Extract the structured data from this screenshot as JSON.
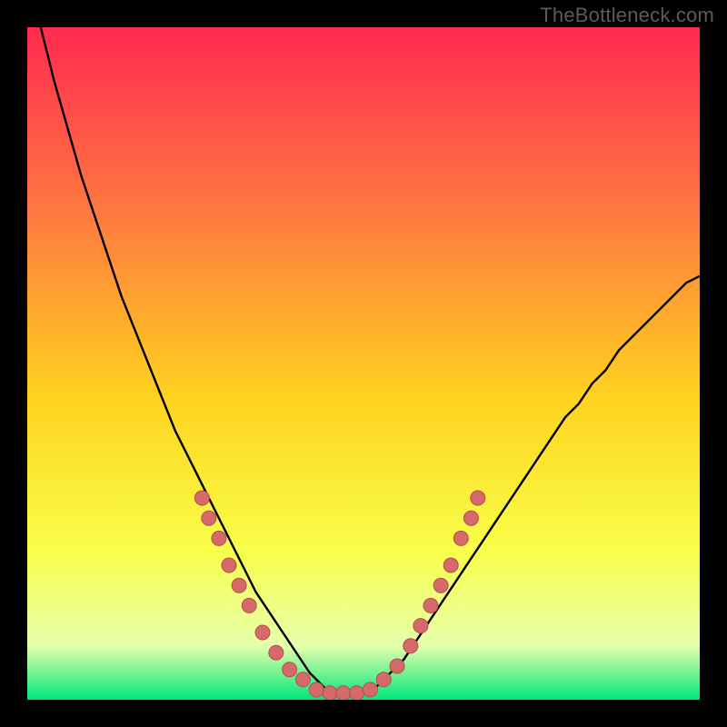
{
  "watermark": "TheBottleneck.com",
  "colors": {
    "frame": "#000000",
    "gradient_top": "#ff2a4f",
    "gradient_mid_upper": "#ff7a3f",
    "gradient_mid": "#ffd21f",
    "gradient_mid_lower": "#f8ff4a",
    "gradient_low": "#e6ffac",
    "gradient_bottom": "#00e67a",
    "curve": "#000000",
    "marker_fill": "#d46a6a",
    "marker_stroke": "#b44d4d"
  },
  "chart_data": {
    "type": "line",
    "title": "",
    "xlabel": "",
    "ylabel": "",
    "xlim": [
      0,
      100
    ],
    "ylim": [
      0,
      100
    ],
    "series": [
      {
        "name": "bottleneck-curve",
        "x": [
          0,
          2,
          4,
          6,
          8,
          10,
          12,
          14,
          16,
          18,
          20,
          22,
          24,
          26,
          28,
          30,
          32,
          34,
          36,
          38,
          40,
          42,
          44,
          45,
          46,
          48,
          50,
          52,
          54,
          56,
          58,
          60,
          62,
          64,
          66,
          68,
          70,
          72,
          74,
          76,
          78,
          80,
          82,
          84,
          86,
          88,
          90,
          92,
          94,
          96,
          98,
          100
        ],
        "y": [
          108,
          100,
          92,
          85,
          78,
          72,
          66,
          60,
          55,
          50,
          45,
          40,
          36,
          32,
          28,
          24,
          20,
          16,
          13,
          10,
          7,
          4,
          2,
          1,
          1,
          1,
          1,
          2,
          4,
          6,
          9,
          12,
          15,
          18,
          21,
          24,
          27,
          30,
          33,
          36,
          39,
          42,
          44,
          47,
          49,
          52,
          54,
          56,
          58,
          60,
          62,
          63
        ]
      }
    ],
    "markers": [
      {
        "x": 26,
        "y": 30
      },
      {
        "x": 27,
        "y": 27
      },
      {
        "x": 28.5,
        "y": 24
      },
      {
        "x": 30,
        "y": 20
      },
      {
        "x": 31.5,
        "y": 17
      },
      {
        "x": 33,
        "y": 14
      },
      {
        "x": 35,
        "y": 10
      },
      {
        "x": 37,
        "y": 7
      },
      {
        "x": 39,
        "y": 4.5
      },
      {
        "x": 41,
        "y": 3
      },
      {
        "x": 43,
        "y": 1.5
      },
      {
        "x": 45,
        "y": 1
      },
      {
        "x": 47,
        "y": 1
      },
      {
        "x": 49,
        "y": 1
      },
      {
        "x": 51,
        "y": 1.5
      },
      {
        "x": 53,
        "y": 3
      },
      {
        "x": 55,
        "y": 5
      },
      {
        "x": 57,
        "y": 8
      },
      {
        "x": 58.5,
        "y": 11
      },
      {
        "x": 60,
        "y": 14
      },
      {
        "x": 61.5,
        "y": 17
      },
      {
        "x": 63,
        "y": 20
      },
      {
        "x": 64.5,
        "y": 24
      },
      {
        "x": 66,
        "y": 27
      },
      {
        "x": 67,
        "y": 30
      }
    ]
  }
}
